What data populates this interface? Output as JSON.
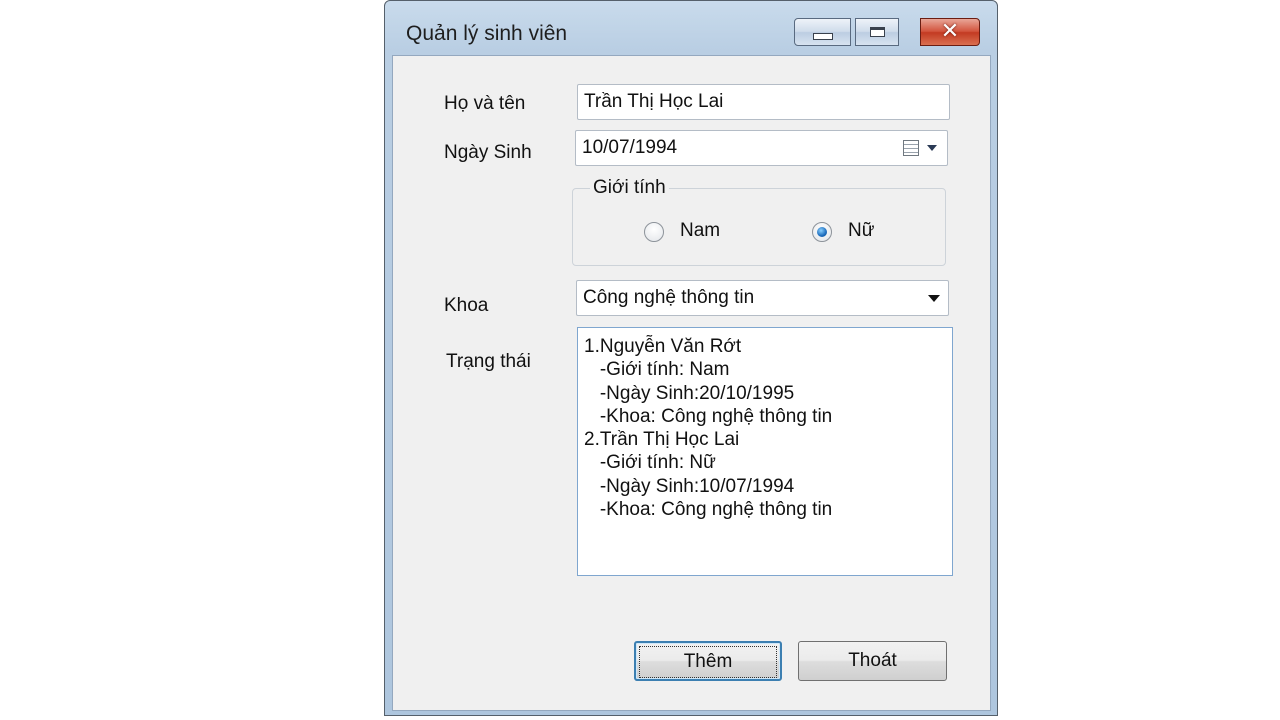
{
  "window": {
    "title": "Quản lý sinh viên",
    "controls": {
      "minimize": "minimize-icon",
      "maximize": "maximize-icon",
      "close": "close-icon"
    }
  },
  "form": {
    "name_label": "Họ và tên",
    "name_value": "Trần Thị Học Lai",
    "dob_label": "Ngày Sinh",
    "dob_value": "10/07/1994",
    "gender_group_title": "Giới tính",
    "gender_options": [
      {
        "label": "Nam",
        "checked": false
      },
      {
        "label": "Nữ",
        "checked": true
      }
    ],
    "faculty_label": "Khoa",
    "faculty_value": "Công nghệ thông tin",
    "status_label": "Trạng thái",
    "status_lines": [
      "1.Nguyễn Văn Rớt",
      "   -Giới tính: Nam",
      "   -Ngày Sinh:20/10/1995",
      "   -Khoa: Công nghệ thông tin",
      "2.Trần Thị Học Lai",
      "   -Giới tính: Nữ",
      "   -Ngày Sinh:10/07/1994",
      "   -Khoa: Công nghệ thông tin"
    ]
  },
  "buttons": {
    "add": "Thêm",
    "exit": "Thoát"
  },
  "colors": {
    "accent": "#3c7fb1",
    "close_button": "#c33a22",
    "frame": "#b9cee3"
  }
}
